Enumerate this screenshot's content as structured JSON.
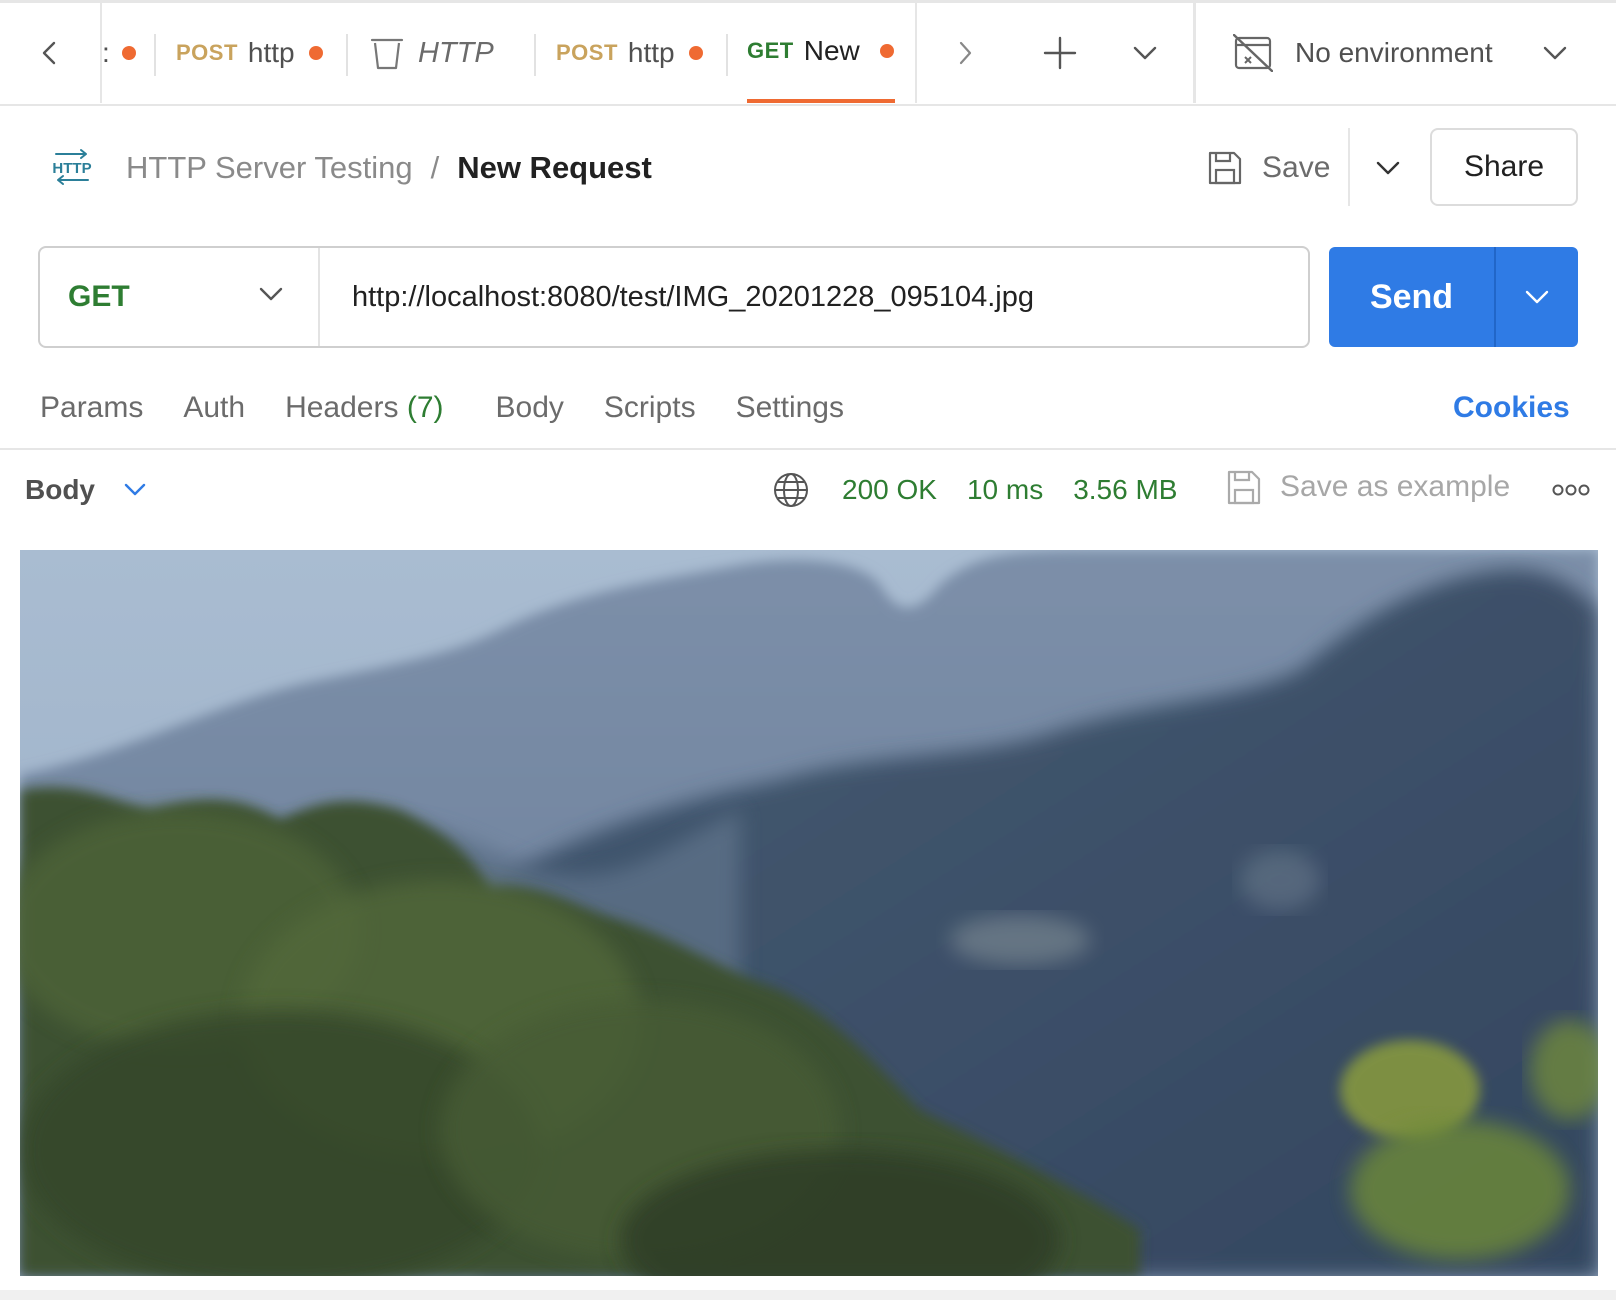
{
  "tabs": {
    "items": [
      {
        "method": "",
        "name": ":",
        "unsaved": true
      },
      {
        "method": "POST",
        "name": "http",
        "unsaved": true
      },
      {
        "method": "",
        "name": "HTTP",
        "unsaved": false,
        "icon": "trash-icon"
      },
      {
        "method": "POST",
        "name": "http",
        "unsaved": true
      },
      {
        "method": "GET",
        "name": "New",
        "unsaved": true,
        "active": true
      }
    ],
    "environment": "No environment"
  },
  "header": {
    "collection_icon": "HTTP",
    "collection": "HTTP Server Testing",
    "separator": "/",
    "request_name": "New Request",
    "save_label": "Save",
    "share_label": "Share"
  },
  "request": {
    "method": "GET",
    "url": "http://localhost:8080/test/IMG_20201228_095104.jpg",
    "send_label": "Send"
  },
  "request_tabs": {
    "params": "Params",
    "auth": "Auth",
    "headers": "Headers",
    "headers_count": "(7)",
    "body": "Body",
    "scripts": "Scripts",
    "settings": "Settings",
    "cookies": "Cookies"
  },
  "response": {
    "body_label": "Body",
    "status": "200 OK",
    "time": "10 ms",
    "size": "3.56 MB",
    "save_example": "Save as example"
  },
  "colors": {
    "accent_orange": "#ef6a32",
    "send_blue": "#2f7be5",
    "get_green": "#2e7d32",
    "post_gold": "#c9a35d"
  }
}
